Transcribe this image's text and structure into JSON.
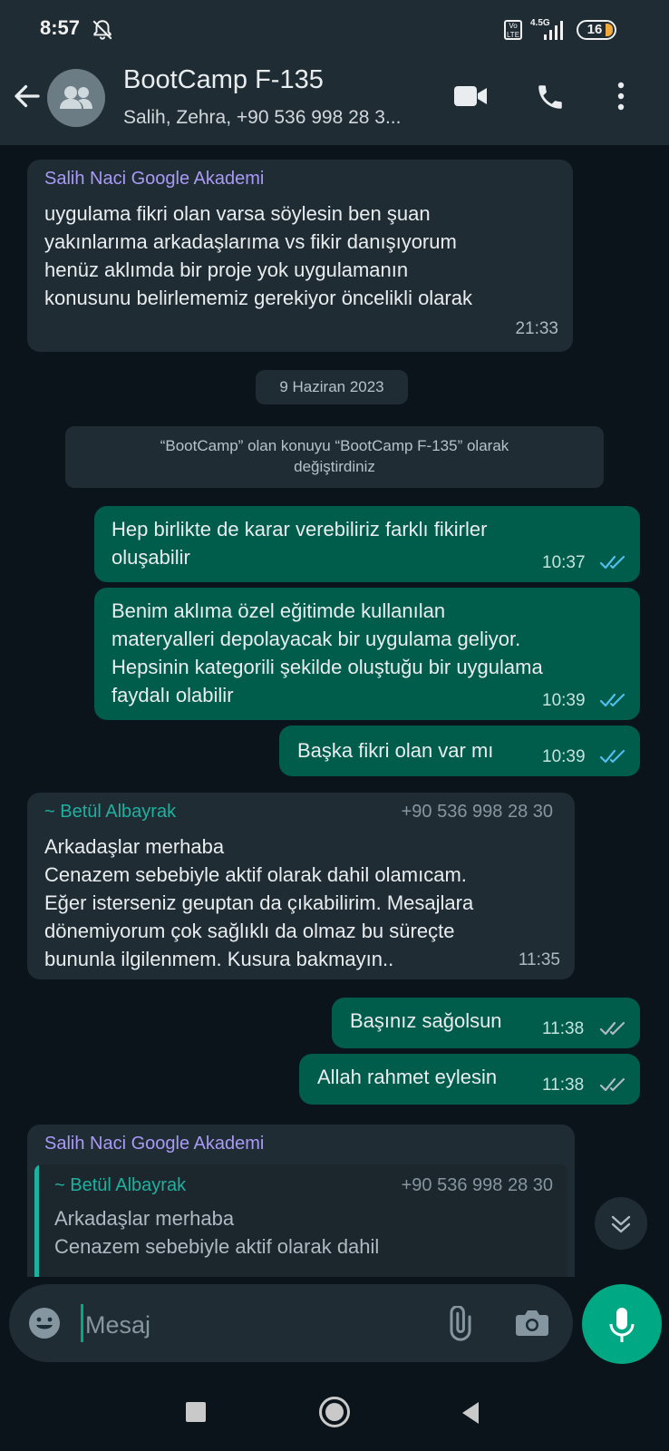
{
  "status_bar": {
    "time": "8:57",
    "network": "4.5G",
    "battery": "16"
  },
  "header": {
    "title": "BootCamp F-135",
    "subtitle": "Salih, Zehra, +90 536 998 28 3..."
  },
  "messages": [
    {
      "sender": "Salih Naci Google Akademi",
      "text": "uygulama fikri olan varsa söylesin ben şuan\nyakınlarıma arkadaşlarıma vs fikir danışıyorum\nhenüz aklımda bir proje yok uygulamanın\nkonusunu belirlememiz gerekiyor öncelikli olarak",
      "time": "21:33"
    },
    {
      "date_chip": "9 Haziran 2023"
    },
    {
      "system_text": "“BootCamp” olan konuyu “BootCamp F-135” olarak\ndeğiştirdiniz"
    },
    {
      "text": "Hep birlikte de karar verebiliriz farklı fikirler\noluşabilir",
      "time": "10:37"
    },
    {
      "text": "Benim aklıma özel eğitimde kullanılan\nmateryalleri depolayacak bir uygulama geliyor.\nHepsinin kategorili şekilde oluştuğu bir uygulama\nfaydalı olabilir",
      "time": "10:39"
    },
    {
      "text": "Başka fikri olan var mı",
      "time": "10:39"
    },
    {
      "sender": "~ Betül Albayrak",
      "phone": "+90 536 998 28 30",
      "text": "Arkadaşlar merhaba\nCenazem sebebiyle aktif olarak dahil olamıcam.\nEğer isterseniz geuptan da çıkabilirim. Mesajlara\ndönemiyorum çok sağlıklı da olmaz bu süreçte\nbununla ilgilenmem. Kusura bakmayın..",
      "time": "11:35"
    },
    {
      "text": "Başınız sağolsun",
      "time": "11:38"
    },
    {
      "text": "Allah rahmet eylesin",
      "time": "11:38"
    },
    {
      "sender": "Salih Naci Google Akademi",
      "quote": {
        "sender": "~ Betül Albayrak",
        "phone": "+90 536 998 28 30",
        "text": "Arkadaşlar merhaba\nCenazem sebebiyle aktif olarak dahil"
      }
    }
  ],
  "input": {
    "placeholder": "Mesaj"
  },
  "colors": {
    "header_bg": "#1f2c34",
    "chat_bg": "#0b141a",
    "incoming_bubble": "#1f2c34",
    "outgoing_bubble": "#005c4b",
    "accent": "#00a884",
    "read_ticks": "#53bdeb",
    "sender_purple": "#a99af5",
    "sender_teal": "#1fb1a0"
  }
}
